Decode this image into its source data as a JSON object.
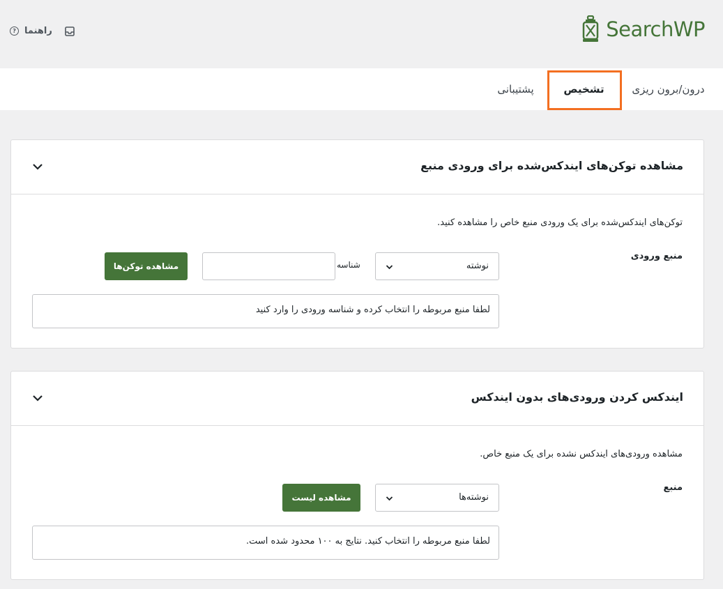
{
  "header": {
    "help_label": "راهنما",
    "help_icon_glyph": "?",
    "logo_text": "SearchWP",
    "brand_color": "#457539"
  },
  "tabs": [
    {
      "label": "درون/برون ریزی",
      "active": false
    },
    {
      "label": "تشخیص",
      "active": true
    },
    {
      "label": "پشتیبانی",
      "active": false
    }
  ],
  "highlight_color": "#f36f21",
  "card_tokens": {
    "title": "مشاهده توکن‌های ایندکس‌شده برای ورودی منبع",
    "description": "توکن‌های ایندکس‌شده برای یک ورودی منبع خاص را مشاهده کنید.",
    "field_label": "منبع ورودی",
    "source_select_value": "نوشته",
    "id_label": "شناسه",
    "id_input_value": "",
    "button_label": "مشاهده توکن‌ها",
    "output_text": "لطفا منبع مربوطه را انتخاب کرده و شناسه ورودی را وارد کنید"
  },
  "card_unindexed": {
    "title": "ایندکس کردن ورودی‌های بدون ایندکس",
    "description": "مشاهده ورودی‌های ایندکس نشده برای یک منبع خاص.",
    "field_label": "منبع",
    "source_select_value": "نوشته‌ها",
    "button_label": "مشاهده لیست",
    "output_text": "لطفا منبع مربوطه را انتخاب کنید. نتایج به ۱۰۰ محدود شده است."
  }
}
